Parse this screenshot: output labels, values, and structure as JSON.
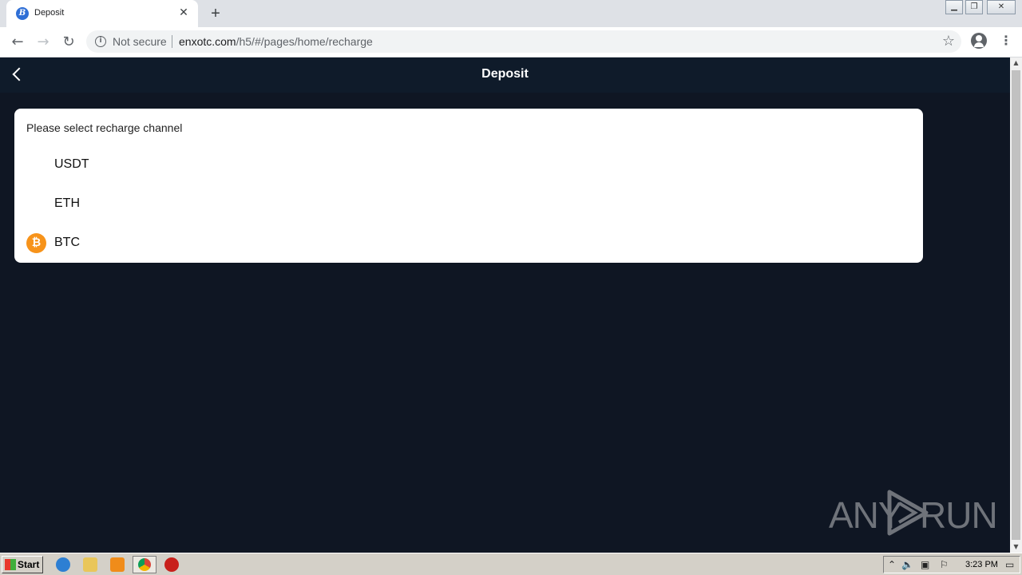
{
  "browser": {
    "tab_title": "Deposit",
    "tab_favicon_glyph": "B",
    "tab_close": "✕",
    "new_tab": "+",
    "security_label": "Not secure",
    "url_host": "enxotc.com",
    "url_path": "/h5/#/pages/home/recharge",
    "window_controls": {
      "minimize": "▁",
      "restore": "❐",
      "close": "✕"
    }
  },
  "header": {
    "title": "Deposit"
  },
  "recharge": {
    "heading": "Please select recharge channel",
    "channels": [
      {
        "label": "USDT",
        "icon": ""
      },
      {
        "label": "ETH",
        "icon": ""
      },
      {
        "label": "BTC",
        "icon": "bitcoin-icon",
        "icon_glyph": "₿",
        "icon_color": "#f7931a"
      }
    ]
  },
  "watermark": {
    "left": "ANY",
    "right": "RUN"
  },
  "taskbar": {
    "start_label": "Start",
    "clock": "3:23 PM"
  },
  "colors": {
    "page_background": "#0f1623",
    "header_background": "#0f1b2a",
    "card_background": "#ffffff"
  }
}
